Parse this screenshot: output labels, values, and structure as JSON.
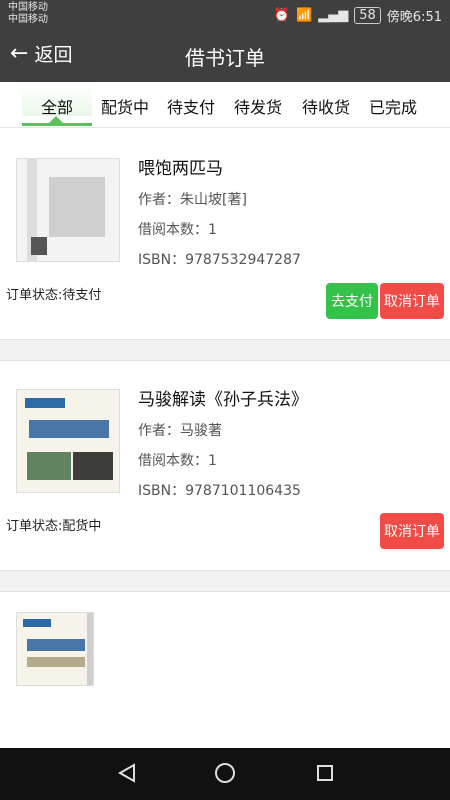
{
  "status_bar": {
    "carrier_1": "中国移动",
    "carrier_2": "中国移动",
    "battery": "58",
    "time": "傍晚6:51"
  },
  "header": {
    "back_label": "返回",
    "title": "借书订单"
  },
  "tabs": [
    {
      "label": "全部",
      "active": true
    },
    {
      "label": "配货中"
    },
    {
      "label": "待支付"
    },
    {
      "label": "待发货"
    },
    {
      "label": "待收货"
    },
    {
      "label": "已完成"
    }
  ],
  "orders": [
    {
      "title": "喂饱两匹马",
      "author_line": "作者：朱山坡[著]",
      "qty_line": "借阅本数：1",
      "isbn_line": "ISBN：9787532947287",
      "status_line": "订单状态:待支付",
      "pay_label": "去支付",
      "cancel_label": "取消订单"
    },
    {
      "title": "马骏解读《孙子兵法》",
      "author_line": "作者：马骏著",
      "qty_line": "借阅本数：1",
      "isbn_line": "ISBN：9787101106435",
      "status_line": "订单状态:配货中",
      "cancel_label": "取消订单"
    },
    {
      "title": "",
      "author_line": "",
      "qty_line": "",
      "isbn_line": "",
      "status_line": ""
    }
  ],
  "colors": {
    "appbar": "#3f3f3f",
    "accent_green": "#35c24b",
    "danger_red": "#f04b46"
  }
}
